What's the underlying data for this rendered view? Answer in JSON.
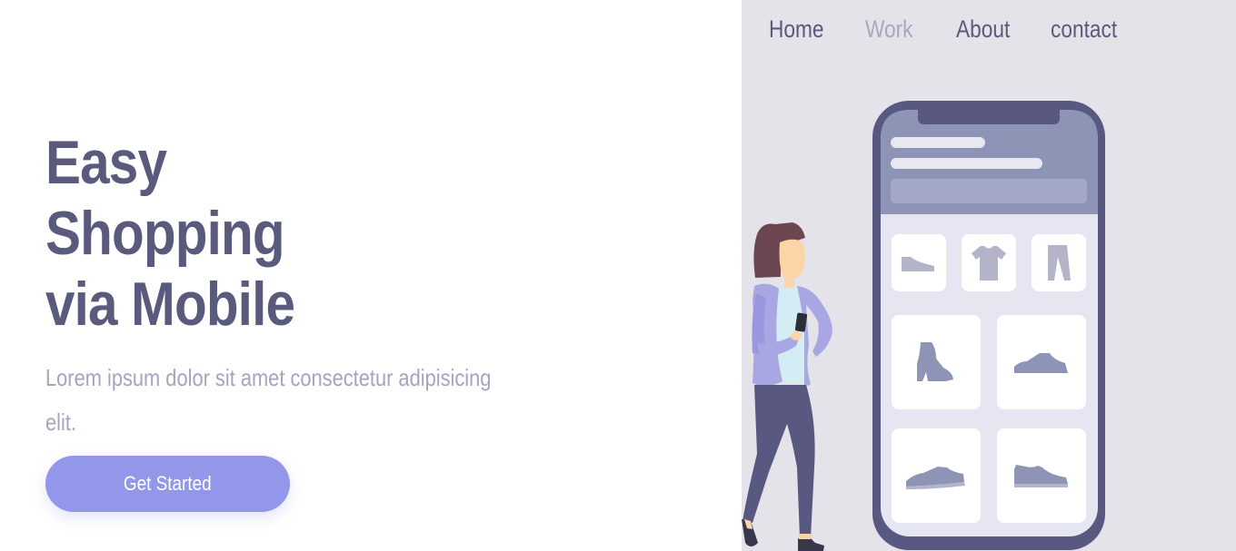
{
  "hero": {
    "headline_lines": [
      "Easy",
      "Shopping",
      "via Mobile"
    ],
    "subtitle": "Lorem ipsum dolor sit amet consectetur adipisicing elit.",
    "cta_label": "Get Started"
  },
  "nav": {
    "items": [
      {
        "label": "Home",
        "active": false
      },
      {
        "label": "Work",
        "active": true
      },
      {
        "label": "About",
        "active": false
      },
      {
        "label": "contact",
        "active": false
      }
    ]
  },
  "colors": {
    "primary_text": "#5a5a7d",
    "muted_text": "#a6a4bf",
    "accent": "#9297e9",
    "panel_bg": "#e4e3ea",
    "phone_frame": "#585880"
  },
  "illustration": {
    "icons": [
      "shoe-flat-icon",
      "tshirt-icon",
      "pants-icon",
      "boot-icon",
      "sneaker-icon",
      "sneaker-icon",
      "sneaker-icon"
    ]
  }
}
